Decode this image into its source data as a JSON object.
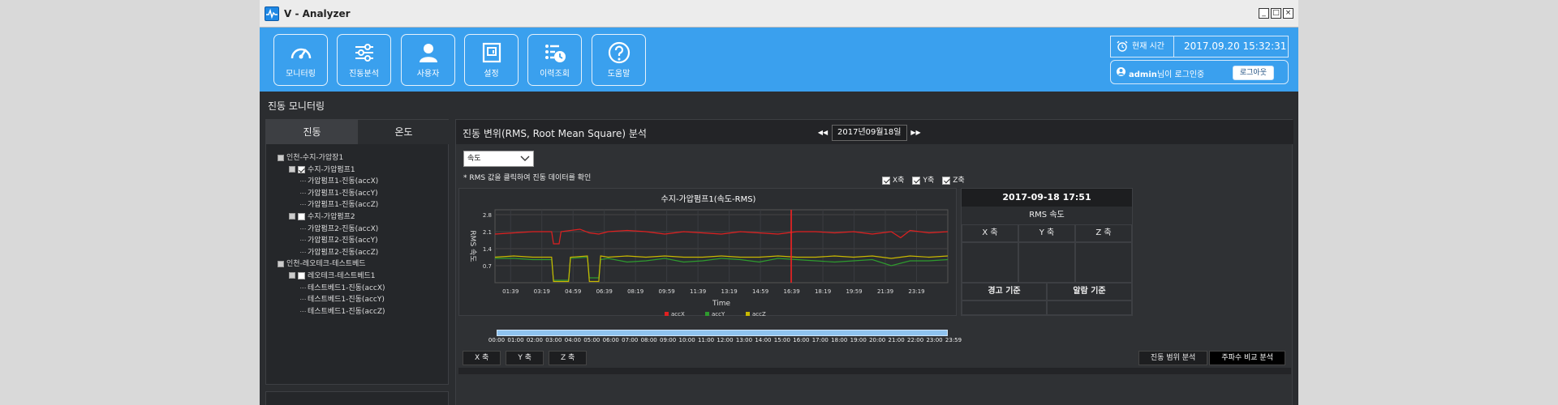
{
  "window": {
    "title": "V - Analyzer",
    "controls": [
      "_",
      "□",
      "×"
    ]
  },
  "nav": [
    {
      "id": "monitoring",
      "label": "모니터링",
      "icon": "gauge-icon"
    },
    {
      "id": "vibration",
      "label": "진동분석",
      "icon": "sliders-icon"
    },
    {
      "id": "user",
      "label": "사용자",
      "icon": "user-icon"
    },
    {
      "id": "settings",
      "label": "설정",
      "icon": "panel-icon"
    },
    {
      "id": "history",
      "label": "이력조회",
      "icon": "history-icon"
    },
    {
      "id": "help",
      "label": "도움말",
      "icon": "help-icon"
    }
  ],
  "clock": {
    "label": "현재 시간",
    "value": "2017.09.20 15:32:31"
  },
  "user": {
    "name": "admin",
    "suffix": "님이 로그인중",
    "logout_label": "로그아웃"
  },
  "page_title": "진동 모니터링",
  "left_tabs": [
    "진동",
    "온도"
  ],
  "tree": [
    {
      "level": 0,
      "label": "인천-수지-가압장1",
      "kind": "root"
    },
    {
      "level": 1,
      "label": "수지-가압펌프1",
      "kind": "group",
      "checked": true
    },
    {
      "level": 2,
      "label": "가압펌프1-진동(accX)",
      "kind": "leaf"
    },
    {
      "level": 2,
      "label": "가압펌프1-진동(accY)",
      "kind": "leaf"
    },
    {
      "level": 2,
      "label": "가압펌프1-진동(accZ)",
      "kind": "leaf"
    },
    {
      "level": 1,
      "label": "수지-가압펌프2",
      "kind": "group",
      "checked": false
    },
    {
      "level": 2,
      "label": "가압펌프2-진동(accX)",
      "kind": "leaf"
    },
    {
      "level": 2,
      "label": "가압펌프2-진동(accY)",
      "kind": "leaf"
    },
    {
      "level": 2,
      "label": "가압펌프2-진동(accZ)",
      "kind": "leaf"
    },
    {
      "level": 0,
      "label": "인천-레오테크-테스트베드",
      "kind": "root"
    },
    {
      "level": 1,
      "label": "레오테크-테스트베드1",
      "kind": "group",
      "checked": false
    },
    {
      "level": 2,
      "label": "테스트베드1-진동(accX)",
      "kind": "leaf"
    },
    {
      "level": 2,
      "label": "테스트베드1-진동(accY)",
      "kind": "leaf"
    },
    {
      "level": 2,
      "label": "테스트베드1-진동(accZ)",
      "kind": "leaf"
    }
  ],
  "panel": {
    "title": "진동 변위(RMS, Root Mean Square) 분석",
    "date": "2017년09월18일",
    "prev_arrow": "◀◀",
    "next_arrow": "▶▶",
    "select_value": "속도",
    "note": "* RMS 값을 클릭하여 진동 데이터를 확인",
    "axis_checks": [
      "X축",
      "Y축",
      "Z축"
    ]
  },
  "chart_data": {
    "type": "line",
    "title": "수지-가압펌프1(속도-RMS)",
    "xlabel": "Time",
    "ylabel": "RMS 속도",
    "x_ticks": [
      "01:39",
      "03:19",
      "04:59",
      "06:39",
      "08:19",
      "09:59",
      "11:39",
      "13:19",
      "14:59",
      "16:39",
      "18:19",
      "19:59",
      "21:39",
      "23:19"
    ],
    "y_ticks": [
      0.7,
      1.4,
      2.1,
      2.8
    ],
    "ylim": [
      0,
      3.0
    ],
    "xlim_hours": [
      0,
      24
    ],
    "cursor_hour": 15.7,
    "grid": true,
    "legend_position": "bottom",
    "series": [
      {
        "name": "accX",
        "color": "#e02020",
        "points": [
          [
            0,
            2.0
          ],
          [
            1.0,
            2.05
          ],
          [
            2.0,
            2.1
          ],
          [
            3.0,
            2.1
          ],
          [
            3.1,
            1.6
          ],
          [
            3.4,
            1.6
          ],
          [
            3.5,
            2.1
          ],
          [
            4.5,
            2.2
          ],
          [
            5.0,
            2.05
          ],
          [
            5.5,
            2.0
          ],
          [
            6.0,
            2.1
          ],
          [
            7.0,
            2.15
          ],
          [
            8.0,
            2.1
          ],
          [
            9.0,
            2.0
          ],
          [
            10.0,
            2.1
          ],
          [
            11.0,
            2.05
          ],
          [
            12.0,
            2.0
          ],
          [
            13.0,
            2.1
          ],
          [
            14.0,
            2.05
          ],
          [
            15.0,
            2.0
          ],
          [
            16.0,
            2.1
          ],
          [
            17.0,
            2.1
          ],
          [
            18.0,
            2.05
          ],
          [
            19.0,
            2.1
          ],
          [
            20.0,
            2.0
          ],
          [
            21.0,
            2.1
          ],
          [
            21.5,
            1.85
          ],
          [
            22.0,
            2.15
          ],
          [
            23.0,
            2.05
          ],
          [
            24.0,
            2.1
          ]
        ]
      },
      {
        "name": "accY",
        "color": "#2e9b2e",
        "points": [
          [
            0,
            1.0
          ],
          [
            1.0,
            1.0
          ],
          [
            2.0,
            0.95
          ],
          [
            3.0,
            0.95
          ],
          [
            3.1,
            0.1
          ],
          [
            3.9,
            0.1
          ],
          [
            4.0,
            1.0
          ],
          [
            4.9,
            1.05
          ],
          [
            5.0,
            0.2
          ],
          [
            5.5,
            0.2
          ],
          [
            5.6,
            0.95
          ],
          [
            6.0,
            1.0
          ],
          [
            7.0,
            0.85
          ],
          [
            8.0,
            0.9
          ],
          [
            9.0,
            1.0
          ],
          [
            10.0,
            0.85
          ],
          [
            11.0,
            0.9
          ],
          [
            12.0,
            1.0
          ],
          [
            13.0,
            0.95
          ],
          [
            14.0,
            0.85
          ],
          [
            15.0,
            1.0
          ],
          [
            16.0,
            0.95
          ],
          [
            17.0,
            0.9
          ],
          [
            18.0,
            0.85
          ],
          [
            19.0,
            0.9
          ],
          [
            20.0,
            0.95
          ],
          [
            21.0,
            0.7
          ],
          [
            22.0,
            0.9
          ],
          [
            23.0,
            0.9
          ],
          [
            24.0,
            0.95
          ]
        ]
      },
      {
        "name": "accZ",
        "color": "#c9b800",
        "points": [
          [
            0,
            1.05
          ],
          [
            1.0,
            1.1
          ],
          [
            2.0,
            1.05
          ],
          [
            3.0,
            1.05
          ],
          [
            3.1,
            0.05
          ],
          [
            3.9,
            0.05
          ],
          [
            4.0,
            1.05
          ],
          [
            4.9,
            1.1
          ],
          [
            5.0,
            0.05
          ],
          [
            5.5,
            0.05
          ],
          [
            5.6,
            1.1
          ],
          [
            6.0,
            1.05
          ],
          [
            7.0,
            1.1
          ],
          [
            8.0,
            1.05
          ],
          [
            9.0,
            1.1
          ],
          [
            10.0,
            1.05
          ],
          [
            11.0,
            1.05
          ],
          [
            12.0,
            1.1
          ],
          [
            13.0,
            1.05
          ],
          [
            14.0,
            1.05
          ],
          [
            15.0,
            1.1
          ],
          [
            16.0,
            1.05
          ],
          [
            17.0,
            1.05
          ],
          [
            18.0,
            1.1
          ],
          [
            19.0,
            1.05
          ],
          [
            20.0,
            1.1
          ],
          [
            21.0,
            1.0
          ],
          [
            22.0,
            1.1
          ],
          [
            23.0,
            1.05
          ],
          [
            24.0,
            1.1
          ]
        ]
      }
    ]
  },
  "info": {
    "datetime": "2017-09-18 17:51",
    "rms_label": "RMS 속도",
    "axes": [
      "X 축",
      "Y 축",
      "Z 축"
    ],
    "warn_label": "경고 기준",
    "alarm_label": "알람 기준"
  },
  "slider_ticks": [
    "00:00",
    "01:00",
    "02:00",
    "03:00",
    "04:00",
    "05:00",
    "06:00",
    "07:00",
    "08:00",
    "09:00",
    "10:00",
    "11:00",
    "12:00",
    "13:00",
    "14:00",
    "15:00",
    "16:00",
    "17:00",
    "18:00",
    "19:00",
    "20:00",
    "21:00",
    "22:00",
    "23:00",
    "23:59"
  ],
  "axis_buttons": [
    "X 축",
    "Y 축",
    "Z 축"
  ],
  "analysis_buttons": [
    {
      "label": "진동 범위 분석",
      "active": false
    },
    {
      "label": "주파수 비교 분석",
      "active": true
    }
  ],
  "colors": {
    "accent": "#3aa0ee",
    "background": "#2b2d30",
    "cursor": "#ff1e1e"
  }
}
